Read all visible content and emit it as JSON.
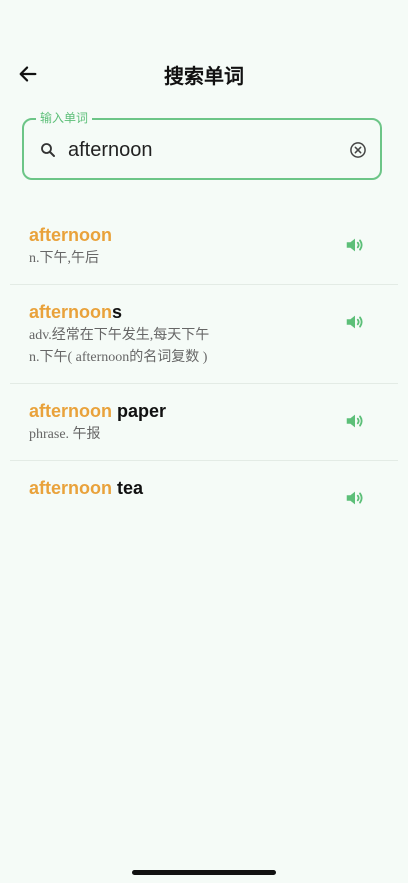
{
  "header": {
    "title": "搜索单词",
    "back_icon": "arrow-left-icon"
  },
  "search": {
    "legend": "输入单词",
    "value": "afternoon",
    "placeholder": "",
    "search_icon": "search-icon",
    "clear_icon": "clear-circle-icon"
  },
  "colors": {
    "accent_green": "#5cbf78",
    "match_orange": "#e9a23b",
    "background": "#f5fbf7"
  },
  "results": [
    {
      "match": "afternoon",
      "rest": "",
      "definitions": [
        "n.下午,午后"
      ]
    },
    {
      "match": "afternoon",
      "rest": "s",
      "definitions": [
        "adv.经常在下午发生,每天下午",
        "n.下午( afternoon的名词复数 )"
      ]
    },
    {
      "match": "afternoon",
      "rest": " paper",
      "definitions": [
        "phrase. 午报"
      ]
    },
    {
      "match": "afternoon",
      "rest": " tea",
      "definitions": []
    }
  ]
}
